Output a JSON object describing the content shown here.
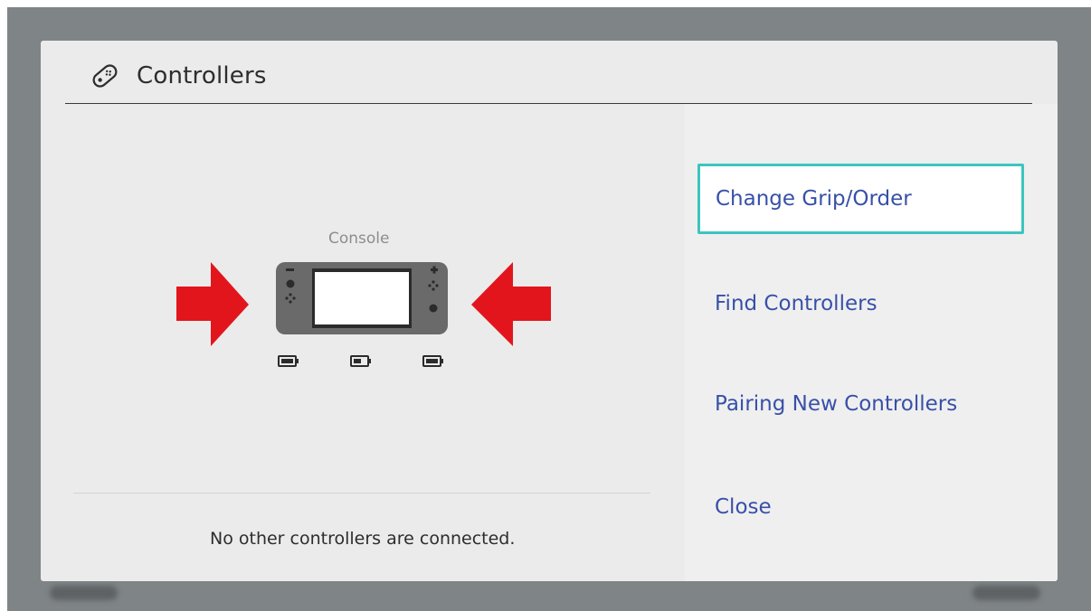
{
  "dialog": {
    "title": "Controllers",
    "title_icon": "controller-icon"
  },
  "console": {
    "label": "Console",
    "left_joycon_battery": "full",
    "docked_battery": "half",
    "right_joycon_battery": "full",
    "arrow_color": "#e3151c"
  },
  "status": {
    "message": "No other controllers are connected."
  },
  "menu": {
    "change_grip_label": "Change Grip/Order",
    "find_controllers_label": "Find Controllers",
    "pairing_label": "Pairing New Controllers",
    "close_label": "Close",
    "selected_border_color": "#3cc5be",
    "link_color": "#3850a8"
  }
}
